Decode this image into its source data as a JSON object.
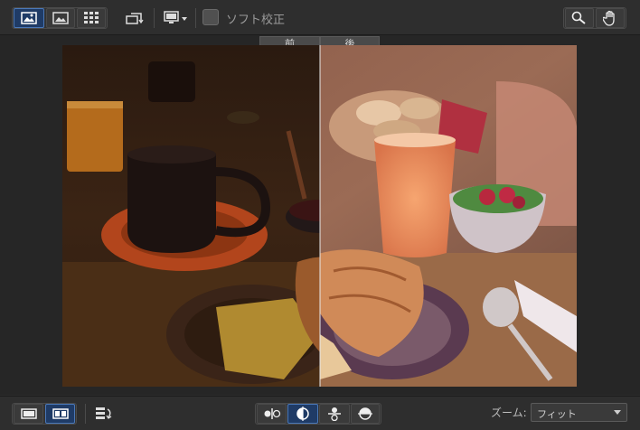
{
  "toolbar": {
    "soft_proof_label": "ソフト校正"
  },
  "viewer": {
    "before_label": "前",
    "after_label": "後"
  },
  "bottom": {
    "zoom_label": "ズーム:",
    "zoom_value": "フィット"
  },
  "colors": {
    "accent": "#1f3b66",
    "panel": "#2e2e2e"
  }
}
